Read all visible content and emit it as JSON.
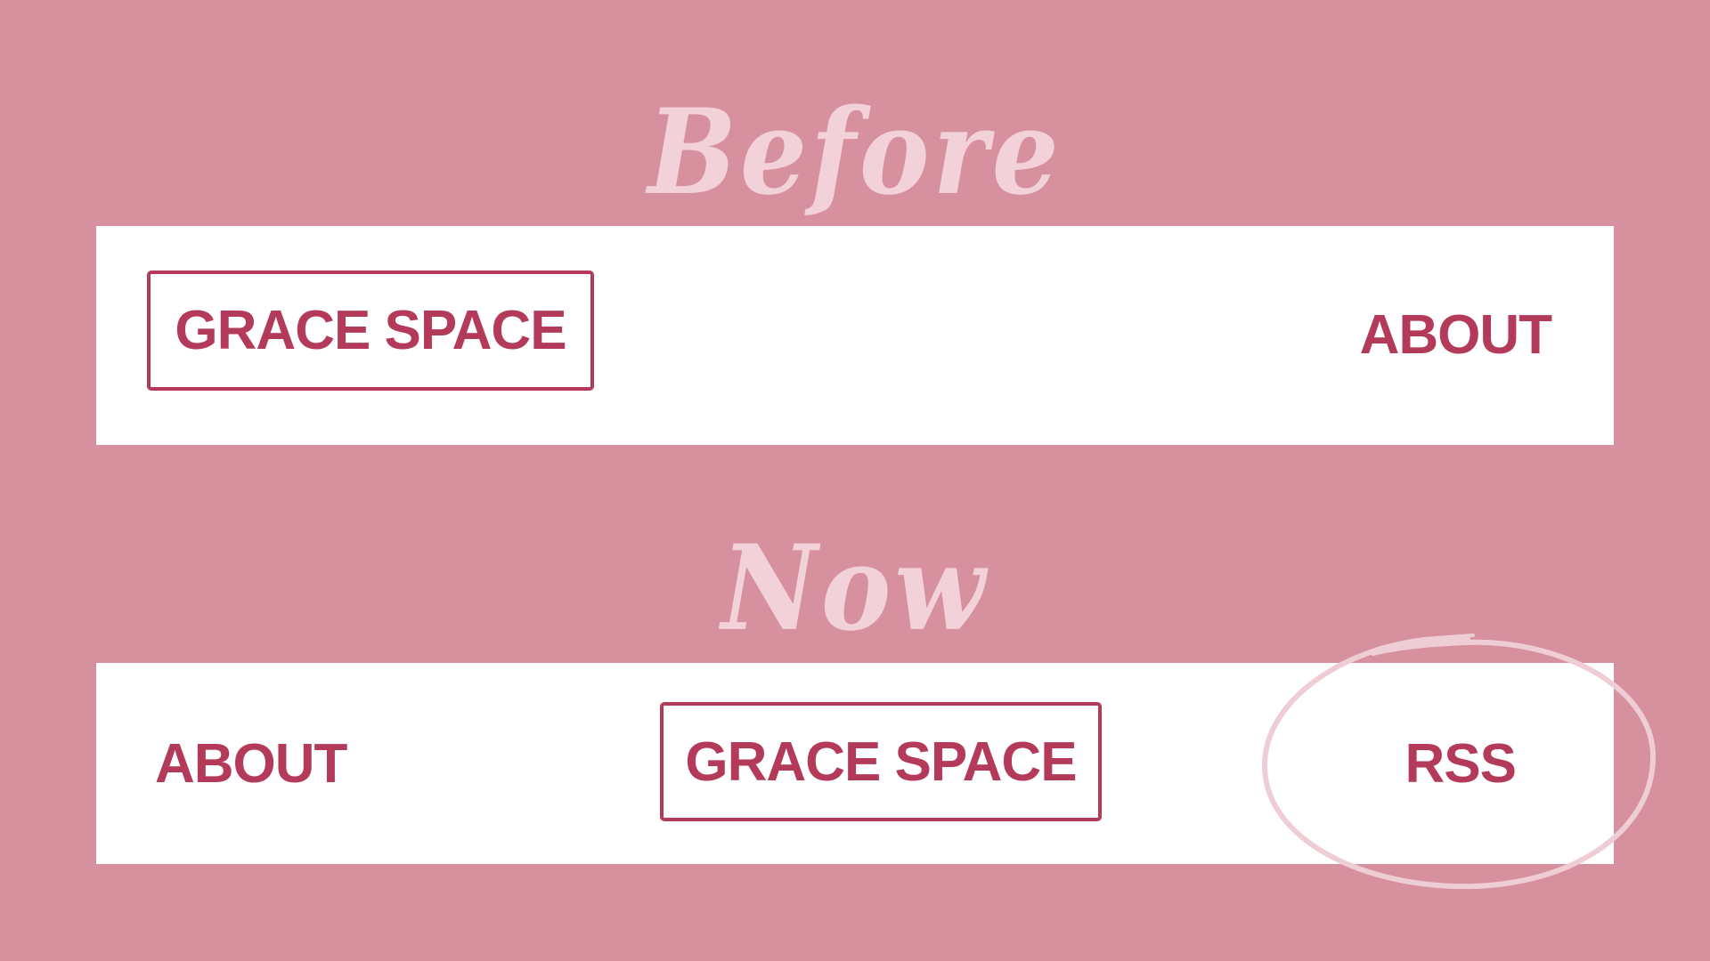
{
  "before": {
    "heading": "Before",
    "brand": "GRACE SPACE",
    "about": "ABOUT"
  },
  "now": {
    "heading": "Now",
    "about": "ABOUT",
    "brand": "GRACE SPACE",
    "rss": "RSS"
  },
  "colors": {
    "background": "#d6909e",
    "heading": "#f2d1d8",
    "bar": "#ffffff",
    "brand_red": "#b43a5a",
    "highlight_circle": "#efcdd5"
  }
}
